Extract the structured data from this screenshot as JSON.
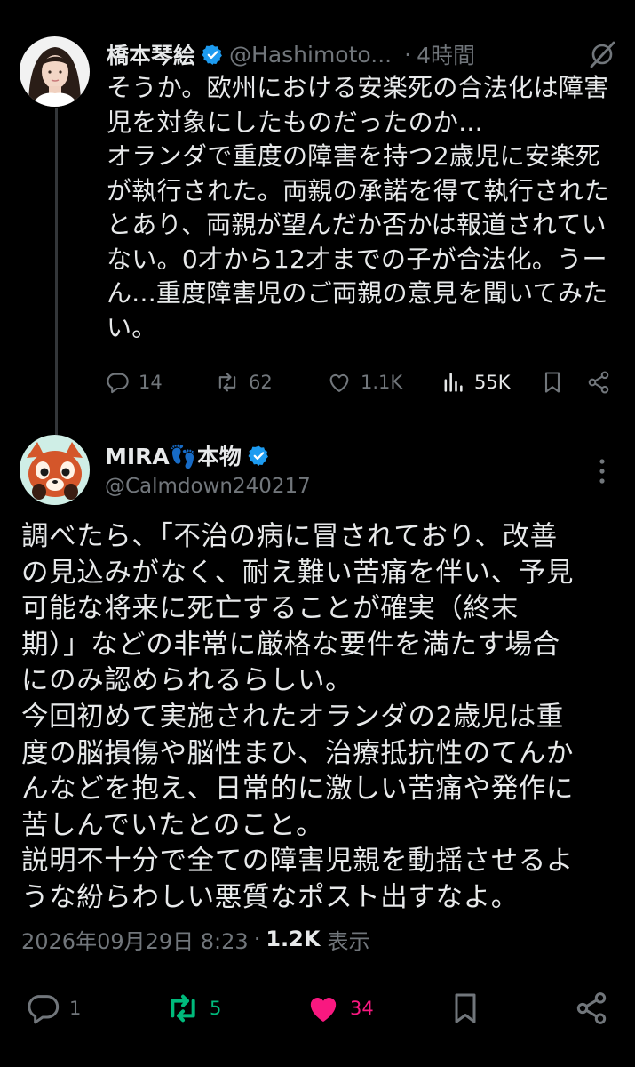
{
  "parent": {
    "name": "橋本琴絵",
    "handle": "@Hashimoto...",
    "separator": "·",
    "time": "4時間",
    "text": "そうか。欧州における安楽死の合法化は障害\n児を対象にしたものだったのか...\nオランダで重度の障害を持つ2歳児に安楽死\nが執行された。両親の承諾を得て執行された\nとあり、両親が望んだか否かは報道されてい\nない。0才から12才までの子が合法化。うー\nん...重度障害児のご両親の意見を聞いてみた\nい。",
    "actions": {
      "replies": "14",
      "reposts": "62",
      "likes": "1.1K",
      "views": "55K"
    }
  },
  "reply": {
    "name": "MIRA👣本物",
    "handle": "@Calmdown240217",
    "text": "調べたら、「不治の病に冒されており、改善\nの見込みがなく、耐え難い苦痛を伴い、予見\n可能な将来に死亡することが確実（終末\n期）」などの非常に厳格な要件を満たす場合\nにのみ認められるらしい。\n今回初めて実施されたオランダの2歳児は重\n度の脳損傷や脳性まひ、治療抵抗性のてんか\nんなどを抱え、日常的に激しい苦痛や発作に\n苦しんでいたとのこと。\n説明不十分で全ての障害児親を動揺させるよ\nうな紛らわしい悪質なポスト出すなよ。",
    "timestamp": "2026年09月29日 8:23",
    "separator": "·",
    "views": "1.2K",
    "views_label": "表示",
    "actions": {
      "replies": "1",
      "reposts": "5",
      "likes": "34"
    }
  },
  "colors": {
    "background": "#000000",
    "text": "#e7e9ea",
    "muted": "#71767b",
    "verified": "#1d9bf0",
    "repost_active": "#00ba7c",
    "like_active": "#f91880",
    "thread_line": "#333639"
  },
  "icons": {
    "verified": "verified-badge-icon",
    "grok": "grok-icon",
    "reply": "reply-icon",
    "repost": "repost-icon",
    "like": "heart-icon",
    "views": "views-icon",
    "bookmark": "bookmark-icon",
    "share": "share-icon",
    "more": "more-vertical-icon"
  }
}
